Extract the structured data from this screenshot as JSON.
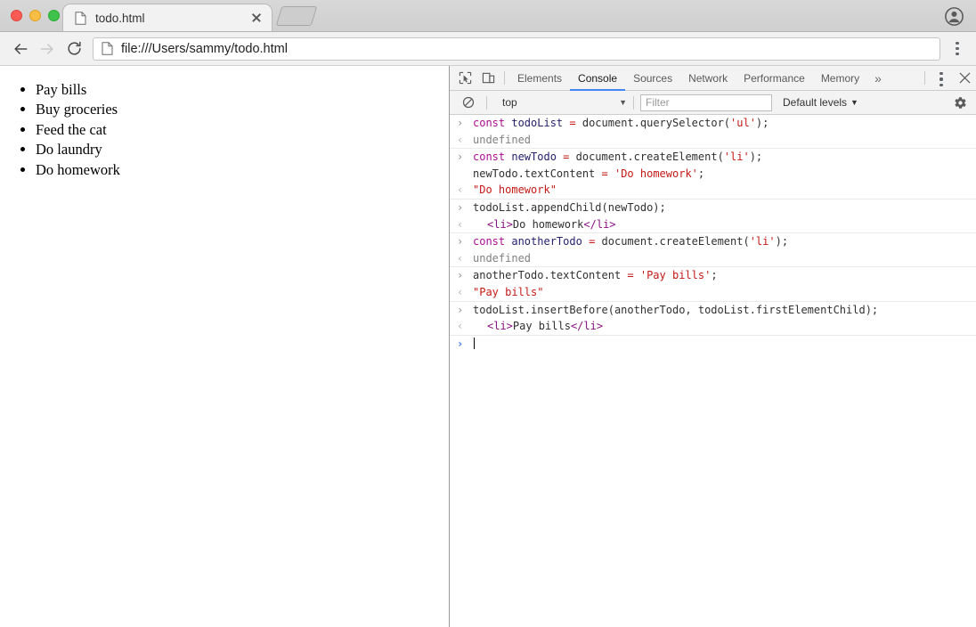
{
  "window": {
    "traffic_lights": [
      "close",
      "minimize",
      "maximize"
    ],
    "profile_icon": "account-circle-icon"
  },
  "tab": {
    "title": "todo.html",
    "favicon": "document-icon",
    "close_icon": "close-icon",
    "new_tab_label": "+"
  },
  "toolbar": {
    "back_icon": "arrow-left-icon",
    "forward_icon": "arrow-right-icon",
    "reload_icon": "reload-icon",
    "url_icon": "document-icon",
    "url": "file:///Users/sammy/todo.html",
    "menu_icon": "kebab-menu-icon"
  },
  "page": {
    "todo_items": [
      "Pay bills",
      "Buy groceries",
      "Feed the cat",
      "Do laundry",
      "Do homework"
    ]
  },
  "devtools": {
    "inspect_icon": "inspect-cursor-icon",
    "device_icon": "device-toolbar-icon",
    "tabs": [
      {
        "label": "Elements",
        "active": false
      },
      {
        "label": "Console",
        "active": true
      },
      {
        "label": "Sources",
        "active": false
      },
      {
        "label": "Network",
        "active": false
      },
      {
        "label": "Performance",
        "active": false
      },
      {
        "label": "Memory",
        "active": false
      }
    ],
    "more_tabs_label": "»",
    "settings_menu_icon": "kebab-menu-icon",
    "close_icon": "close-icon",
    "filterbar": {
      "clear_icon": "clear-console-icon",
      "context": "top",
      "context_caret": "▼",
      "filter_placeholder": "Filter",
      "levels_label": "Default levels",
      "levels_caret": "▼",
      "gear_icon": "settings-gear-icon"
    },
    "gutter": {
      "input": "›",
      "output": "‹",
      "prompt": "›"
    },
    "console_rows": [
      {
        "type": "input",
        "separator": false,
        "tokens": [
          {
            "cls": "tok-kw",
            "t": "const"
          },
          {
            "cls": "tok-pln",
            "t": " "
          },
          {
            "cls": "tok-var",
            "t": "todoList"
          },
          {
            "cls": "tok-pln",
            "t": " "
          },
          {
            "cls": "tok-op",
            "t": "="
          },
          {
            "cls": "tok-pln",
            "t": " document.querySelector("
          },
          {
            "cls": "tok-str",
            "t": "'ul'"
          },
          {
            "cls": "tok-pln",
            "t": ");"
          }
        ]
      },
      {
        "type": "output",
        "separator": false,
        "tokens": [
          {
            "cls": "out-undef",
            "t": "undefined"
          }
        ]
      },
      {
        "type": "input",
        "separator": true,
        "tokens": [
          {
            "cls": "tok-kw",
            "t": "const"
          },
          {
            "cls": "tok-pln",
            "t": " "
          },
          {
            "cls": "tok-var",
            "t": "newTodo"
          },
          {
            "cls": "tok-pln",
            "t": " "
          },
          {
            "cls": "tok-op",
            "t": "="
          },
          {
            "cls": "tok-pln",
            "t": " document.createElement("
          },
          {
            "cls": "tok-str",
            "t": "'li'"
          },
          {
            "cls": "tok-pln",
            "t": ");\nnewTodo.textContent "
          },
          {
            "cls": "tok-op",
            "t": "="
          },
          {
            "cls": "tok-pln",
            "t": " "
          },
          {
            "cls": "tok-str",
            "t": "'Do homework'"
          },
          {
            "cls": "tok-pln",
            "t": ";"
          }
        ]
      },
      {
        "type": "output",
        "separator": false,
        "tokens": [
          {
            "cls": "out-str",
            "t": "\"Do homework\""
          }
        ]
      },
      {
        "type": "input",
        "separator": true,
        "tokens": [
          {
            "cls": "tok-pln",
            "t": "todoList.appendChild(newTodo);"
          }
        ]
      },
      {
        "type": "output",
        "separator": false,
        "tokens": [
          {
            "cls": "indent",
            "t": ""
          },
          {
            "cls": "tok-tag",
            "t": "<li>"
          },
          {
            "cls": "tok-text",
            "t": "Do homework"
          },
          {
            "cls": "tok-tag",
            "t": "</li>"
          }
        ]
      },
      {
        "type": "input",
        "separator": true,
        "tokens": [
          {
            "cls": "tok-kw",
            "t": "const"
          },
          {
            "cls": "tok-pln",
            "t": " "
          },
          {
            "cls": "tok-var",
            "t": "anotherTodo"
          },
          {
            "cls": "tok-pln",
            "t": " "
          },
          {
            "cls": "tok-op",
            "t": "="
          },
          {
            "cls": "tok-pln",
            "t": " document.createElement("
          },
          {
            "cls": "tok-str",
            "t": "'li'"
          },
          {
            "cls": "tok-pln",
            "t": ");"
          }
        ]
      },
      {
        "type": "output",
        "separator": false,
        "tokens": [
          {
            "cls": "out-undef",
            "t": "undefined"
          }
        ]
      },
      {
        "type": "input",
        "separator": true,
        "tokens": [
          {
            "cls": "tok-pln",
            "t": "anotherTodo.textContent "
          },
          {
            "cls": "tok-op",
            "t": "="
          },
          {
            "cls": "tok-pln",
            "t": " "
          },
          {
            "cls": "tok-str",
            "t": "'Pay bills'"
          },
          {
            "cls": "tok-pln",
            "t": ";"
          }
        ]
      },
      {
        "type": "output",
        "separator": false,
        "tokens": [
          {
            "cls": "out-str",
            "t": "\"Pay bills\""
          }
        ]
      },
      {
        "type": "input",
        "separator": true,
        "tokens": [
          {
            "cls": "tok-pln",
            "t": "todoList.insertBefore(anotherTodo, todoList.firstElementChild);"
          }
        ]
      },
      {
        "type": "output",
        "separator": false,
        "tokens": [
          {
            "cls": "indent",
            "t": ""
          },
          {
            "cls": "tok-tag",
            "t": "<li>"
          },
          {
            "cls": "tok-text",
            "t": "Pay bills"
          },
          {
            "cls": "tok-tag",
            "t": "</li>"
          }
        ]
      },
      {
        "type": "prompt",
        "separator": true,
        "tokens": []
      }
    ]
  },
  "colors": {
    "accent": "#4285f4",
    "keyword": "#aa0d91",
    "string": "#c41a16",
    "variable": "#26216e",
    "tag": "#881280",
    "chrome_bg": "#f1f1f1"
  }
}
